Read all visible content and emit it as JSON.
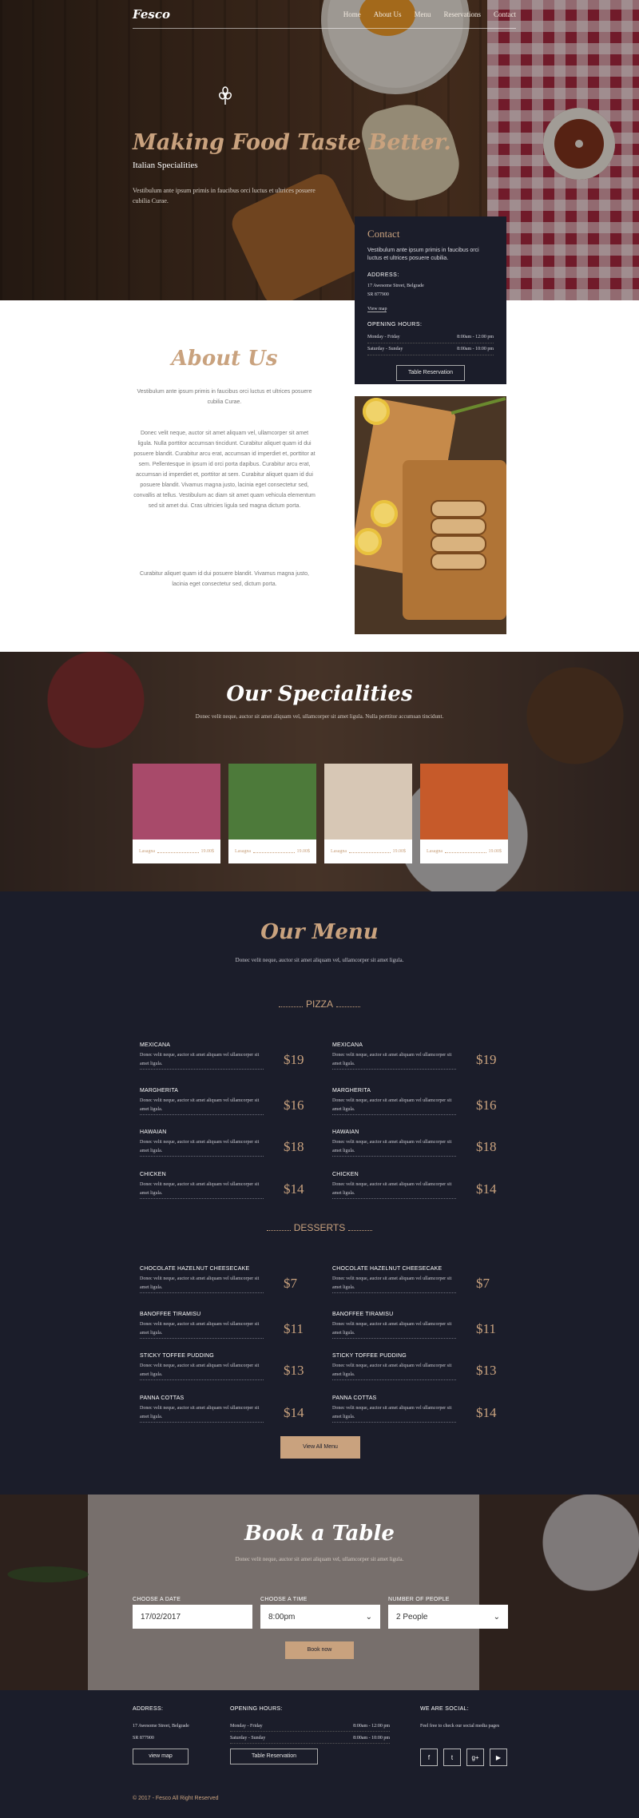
{
  "nav": {
    "logo": "Fesco",
    "items": [
      "Home",
      "About Us",
      "Menu",
      "Reservations",
      "Contact"
    ]
  },
  "hero": {
    "icon": "wheat-icon",
    "title": "Making Food Taste Better.",
    "subtitle": "Italian Specialities",
    "text": "Vestibulum ante ipsum primis in faucibus orci luctus et ultrices posuere cubilia Curae."
  },
  "contact": {
    "title": "Contact",
    "intro": "Vestibulum ante ipsum primis in faucibus orci luctus et ultrices posuere cubilia.",
    "address_label": "ADDRESS:",
    "address_line1": "17 Awesome Street, Belgrade",
    "address_line2": "SR 877900",
    "view_map": "View map",
    "hours_label": "OPENING HOURS:",
    "hours": [
      {
        "day": "Monday - Friday",
        "time": "8:00am - 12:00 pm"
      },
      {
        "day": "Saturday - Sunday",
        "time": "8:00am - 10:00 pm"
      }
    ],
    "button": "Table Reservation"
  },
  "about": {
    "title": "About Us",
    "lead": "Vestibulum ante ipsum primis in faucibus orci luctus et ultrices posuere cubilia Curae.",
    "body": "Donec velit neque, auctor sit amet aliquam vel, ullamcorper sit amet ligula. Nulla porttitor accumsan tincidunt. Curabitur aliquet quam id dui posuere blandit. Curabitur arcu erat, accumsan id imperdiet et, porttitor at sem. Pellentesque in ipsum id orci porta dapibus. Curabitur arcu erat, accumsan id imperdiet et, porttitor at sem. Curabitur aliquet quam id dui posuere blandit. Vivamus magna justo, lacinia eget consectetur sed, convallis at tellus. Vestibulum ac diam sit amet quam vehicula elementum sed sit amet dui. Cras ultricies ligula sed magna dictum porta.",
    "closing": "Curabitur aliquet quam id dui posuere blandit. Vivamus magna justo, lacinia eget consectetur sed, dictum porta."
  },
  "specialities": {
    "title": "Our Specialities",
    "text": "Donec velit neque, auctor sit amet aliquam vel, ullamcorper sit amet ligula. Nulla porttitor accumsan tincidunt.",
    "cards": [
      {
        "name": "Lasagna",
        "price": "19.00$",
        "color": "#a84a6a"
      },
      {
        "name": "Lasagna",
        "price": "19.00$",
        "color": "#4d7a3a"
      },
      {
        "name": "Lasagna",
        "price": "19.00$",
        "color": "#d7c7b5"
      },
      {
        "name": "Lasagna",
        "price": "19.00$",
        "color": "#c65a2a"
      }
    ]
  },
  "menu": {
    "title": "Our Menu",
    "subtitle": "Donec velit neque, auctor sit amet aliquam vel, ullamcorper sit amet ligula.",
    "categories": [
      {
        "name": "PIZZA",
        "items": [
          {
            "name": "MEXICANA",
            "desc": "Donec velit neque, auctor sit amet aliquam vel ullamcorper sit amet ligula.",
            "price": "$19"
          },
          {
            "name": "MEXICANA",
            "desc": "Donec velit neque, auctor sit amet aliquam vel ullamcorper sit amet ligula.",
            "price": "$19"
          },
          {
            "name": "MARGHERITA",
            "desc": "Donec velit neque, auctor sit amet aliquam vel ullamcorper sit amet ligula.",
            "price": "$16"
          },
          {
            "name": "MARGHERITA",
            "desc": "Donec velit neque, auctor sit amet aliquam vel ullamcorper sit amet ligula.",
            "price": "$16"
          },
          {
            "name": "HAWAIAN",
            "desc": "Donec velit neque, auctor sit amet aliquam vel ullamcorper sit amet ligula.",
            "price": "$18"
          },
          {
            "name": "HAWAIAN",
            "desc": "Donec velit neque, auctor sit amet aliquam vel ullamcorper sit amet ligula.",
            "price": "$18"
          },
          {
            "name": "CHICKEN",
            "desc": "Donec velit neque, auctor sit amet aliquam vel ullamcorper sit amet ligula.",
            "price": "$14"
          },
          {
            "name": "CHICKEN",
            "desc": "Donec velit neque, auctor sit amet aliquam vel ullamcorper sit amet ligula.",
            "price": "$14"
          }
        ]
      },
      {
        "name": "DESSERTS",
        "items": [
          {
            "name": "CHOCOLATE HAZELNUT CHEESECAKE",
            "desc": "Donec velit neque, auctor sit amet aliquam vel ullamcorper sit amet ligula.",
            "price": "$7"
          },
          {
            "name": "CHOCOLATE HAZELNUT CHEESECAKE",
            "desc": "Donec velit neque, auctor sit amet aliquam vel ullamcorper sit amet ligula.",
            "price": "$7"
          },
          {
            "name": "BANOFFEE TIRAMISU",
            "desc": "Donec velit neque, auctor sit amet aliquam vel ullamcorper sit amet ligula.",
            "price": "$11"
          },
          {
            "name": "BANOFFEE TIRAMISU",
            "desc": "Donec velit neque, auctor sit amet aliquam vel ullamcorper sit amet ligula.",
            "price": "$11"
          },
          {
            "name": "STICKY TOFFEE PUDDING",
            "desc": "Donec velit neque, auctor sit amet aliquam vel ullamcorper sit amet ligula.",
            "price": "$13"
          },
          {
            "name": "STICKY TOFFEE PUDDING",
            "desc": "Donec velit neque, auctor sit amet aliquam vel ullamcorper sit amet ligula.",
            "price": "$13"
          },
          {
            "name": "PANNA COTTAS",
            "desc": "Donec velit neque, auctor sit amet aliquam vel ullamcorper sit amet ligula.",
            "price": "$14"
          },
          {
            "name": "PANNA COTTAS",
            "desc": "Donec velit neque, auctor sit amet aliquam vel ullamcorper sit amet ligula.",
            "price": "$14"
          }
        ]
      }
    ],
    "view_all": "View All Menu"
  },
  "book": {
    "title": "Book a Table",
    "subtitle": "Donec velit neque, auctor sit amet aliquam vel, ullamcorper sit amet ligula.",
    "date_label": "CHOOSE A DATE",
    "date_value": "17/02/2017",
    "time_label": "CHOOSE A TIME",
    "time_value": "8:00pm",
    "people_label": "NUMBER OF PEOPLE",
    "people_value": "2 People",
    "button": "Book now"
  },
  "footer": {
    "address_label": "ADDRESS:",
    "address_line1": "17 Awesome Street, Belgrade",
    "address_line2": "SR 877900",
    "view_map": "view map",
    "hours_label": "OPENING HOURS:",
    "hours": [
      {
        "day": "Monday - Friday",
        "time": "8:00am - 12:00 pm"
      },
      {
        "day": "Saturday - Sunday",
        "time": "8:00am - 10:00 pm"
      }
    ],
    "reservation_button": "Table Reservation",
    "social_label": "WE ARE SOCIAL:",
    "social_text": "Feel free to check our social media pages",
    "social_icons": [
      {
        "name": "facebook-icon",
        "glyph": "f"
      },
      {
        "name": "twitter-icon",
        "glyph": "t"
      },
      {
        "name": "google-plus-icon",
        "glyph": "g+"
      },
      {
        "name": "youtube-icon",
        "glyph": "▶"
      }
    ],
    "copyright": "© 2017 - Fesco All Right Reserved"
  },
  "colors": {
    "accent": "#c9a27e",
    "dark": "#1b1d2a"
  }
}
